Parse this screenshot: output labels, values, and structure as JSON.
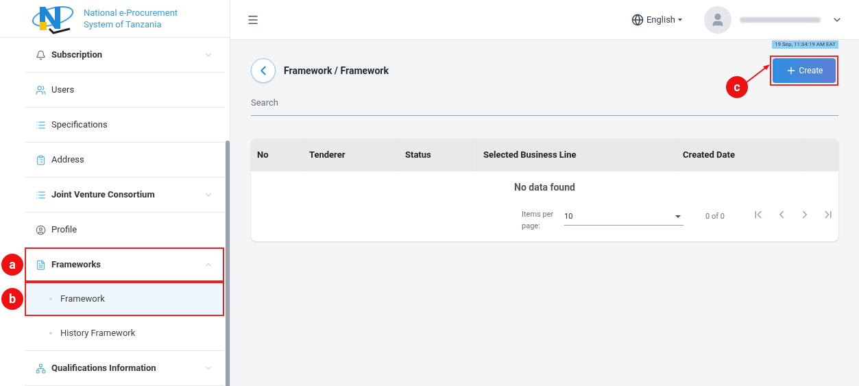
{
  "brand": {
    "line_1": "National e-Procurement",
    "line_2": "System of Tanzania"
  },
  "sidebar": {
    "items": [
      {
        "label": "Subscription",
        "expandable": true,
        "expanded": false,
        "selected": false
      },
      {
        "label": "Users",
        "expandable": false,
        "selected": false
      },
      {
        "label": "Specifications",
        "expandable": false,
        "selected": false
      },
      {
        "label": "Address",
        "expandable": false,
        "selected": false
      },
      {
        "label": "Joint Venture Consortium",
        "expandable": true,
        "expanded": false,
        "selected": false
      },
      {
        "label": "Profile",
        "expandable": false,
        "selected": false
      },
      {
        "label": "Frameworks",
        "expandable": true,
        "expanded": true,
        "selected": false,
        "annotation": "a",
        "children": [
          {
            "label": "Framework",
            "selected": true,
            "annotation": "b"
          },
          {
            "label": "History Framework",
            "selected": false
          }
        ]
      },
      {
        "label": "Qualifications Information",
        "expandable": true,
        "expanded": false,
        "selected": false
      }
    ]
  },
  "header": {
    "language": "English",
    "timestamp": "19 Sep, 11:34:19 AM EAT"
  },
  "page": {
    "breadcrumb": "Framework / Framework",
    "create_button": {
      "label": "Create",
      "annotation": "c"
    },
    "search": {
      "placeholder": "Search"
    }
  },
  "table": {
    "columns": [
      "No",
      "Tenderer",
      "Status",
      "Selected Business Line",
      "Created Date"
    ],
    "empty_message": "No data found",
    "paginator": {
      "items_per_page_label": "Items per page:",
      "page_size": "10",
      "range": "0 of 0"
    }
  }
}
